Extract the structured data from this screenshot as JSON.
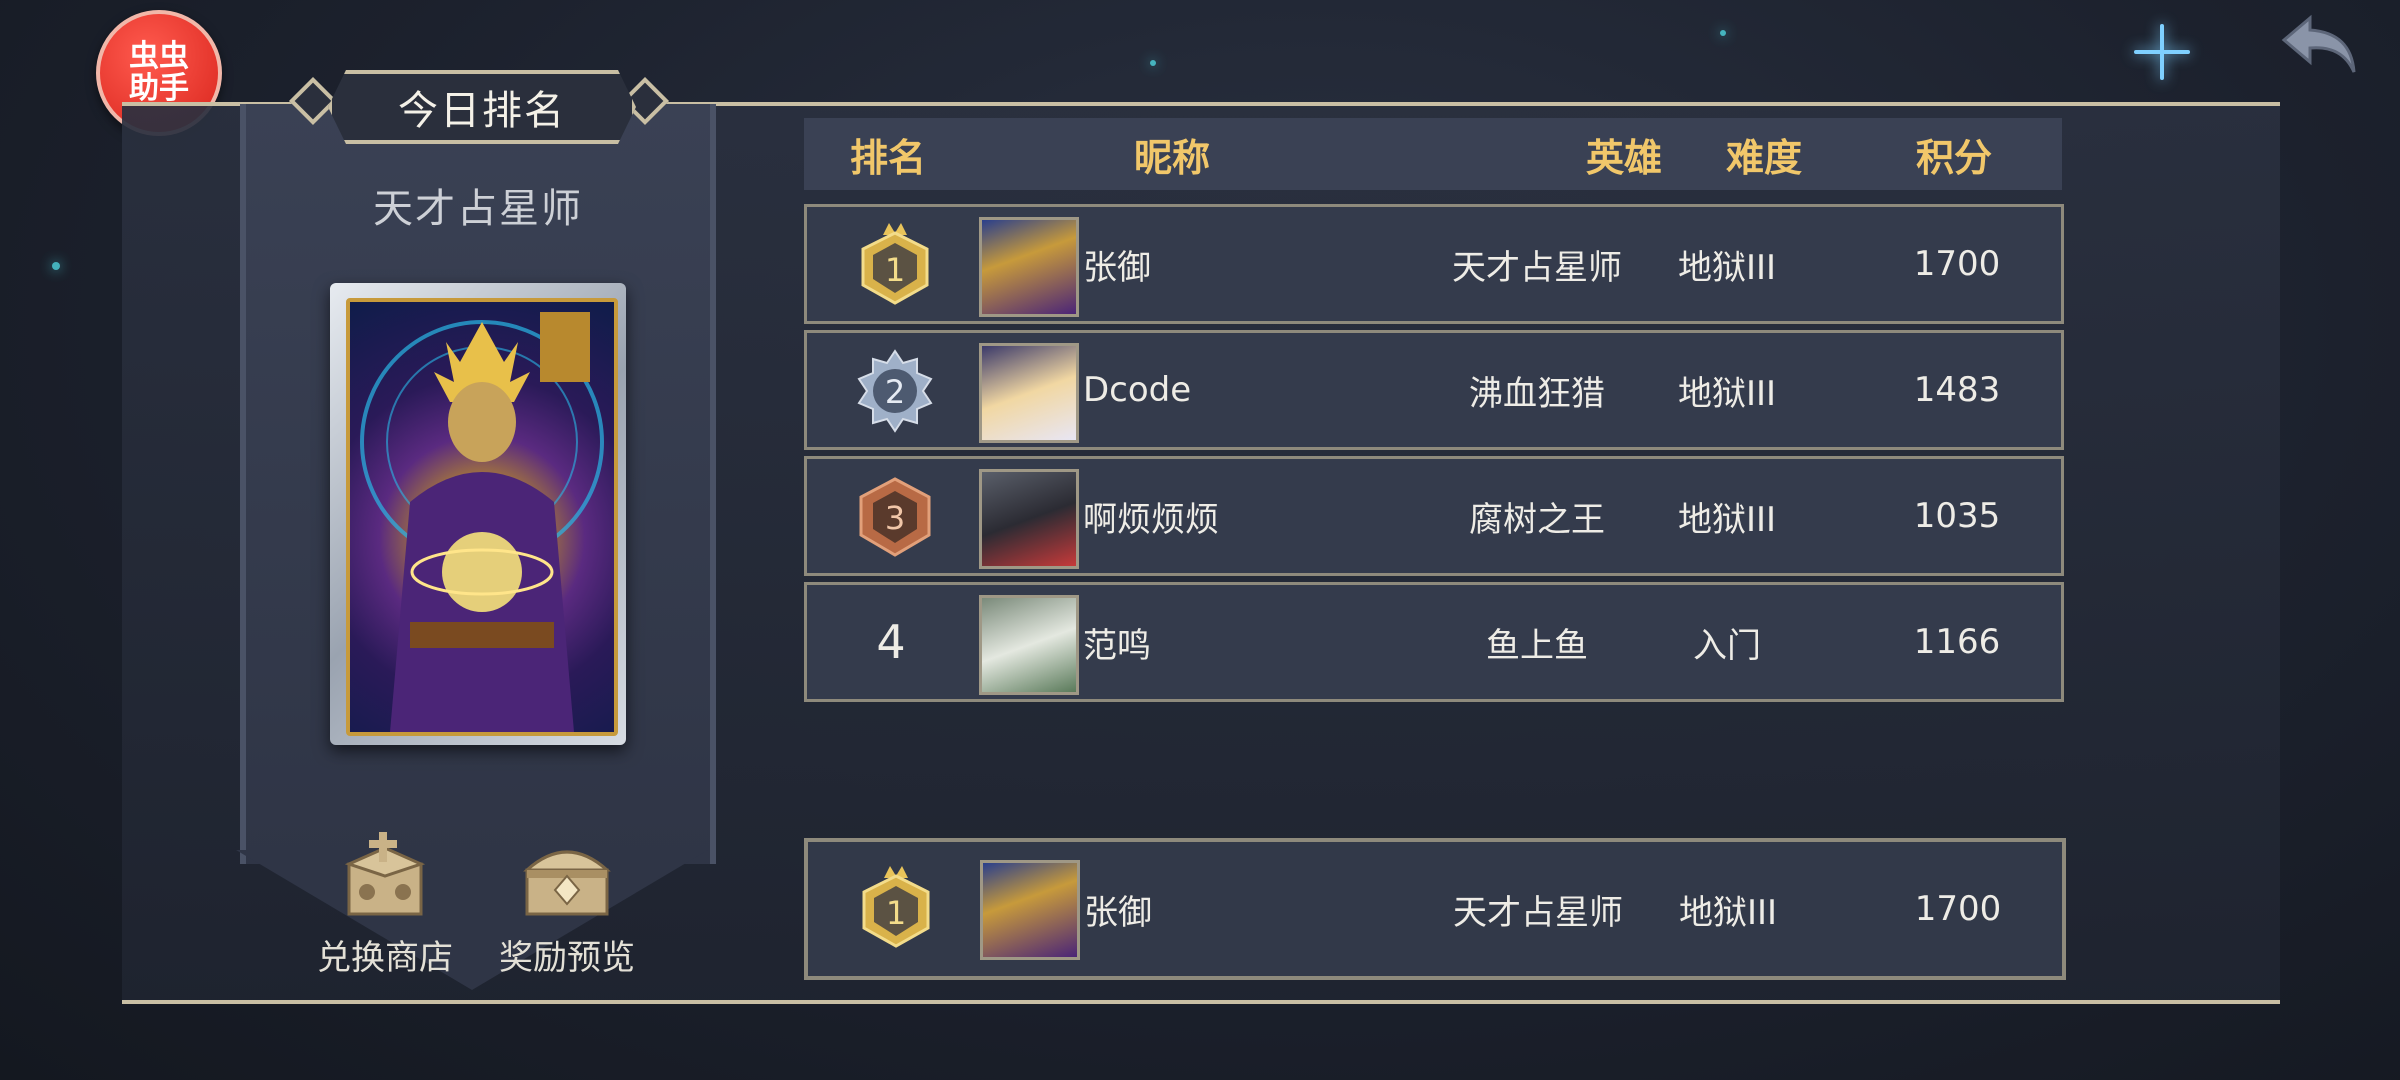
{
  "app_badge": {
    "line1": "虫虫",
    "line2": "助手"
  },
  "panel": {
    "title": "今日排名",
    "hero_name": "天才占星师",
    "shop_label": "兑换商店",
    "reward_label": "奖励预览"
  },
  "table": {
    "headers": {
      "rank": "排名",
      "nickname": "昵称",
      "hero": "英雄",
      "difficulty": "难度",
      "score": "积分"
    },
    "rows": [
      {
        "rank": "1",
        "nickname": "张御",
        "hero": "天才占星师",
        "difficulty": "地狱III",
        "score": "1700"
      },
      {
        "rank": "2",
        "nickname": "Dcode",
        "hero": "沸血狂猎",
        "difficulty": "地狱III",
        "score": "1483"
      },
      {
        "rank": "3",
        "nickname": "啊烦烦烦",
        "hero": "腐树之王",
        "difficulty": "地狱III",
        "score": "1035"
      },
      {
        "rank": "4",
        "nickname": "范鸣",
        "hero": "鱼上鱼",
        "difficulty": "入门",
        "score": "1166"
      }
    ],
    "self": {
      "rank": "1",
      "nickname": "张御",
      "hero": "天才占星师",
      "difficulty": "地狱III",
      "score": "1700"
    }
  },
  "colors": {
    "header_text": "#f1c76a",
    "gold_medal": "#d9b24a",
    "silver_medal": "#9fb0c8",
    "bronze_medal": "#b86a45",
    "badge_red": "#d8241c"
  },
  "icons": {
    "back": "back-arrow-icon",
    "shop": "treasure-box-icon",
    "reward": "treasure-chest-icon",
    "medal": "rank-medal-icon"
  }
}
